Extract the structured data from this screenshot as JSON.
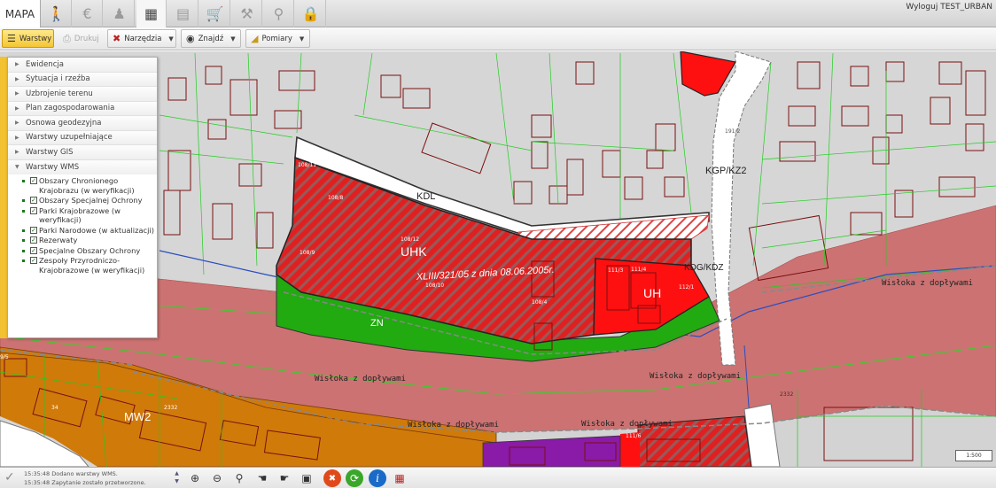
{
  "topbar": {
    "tab_label": "MAPA",
    "icons": [
      "walking-person-icon",
      "euro-icon",
      "person-icon",
      "building-icon",
      "document-list-icon",
      "cart-icon",
      "hammer-icon",
      "search-icon",
      "lock-icon"
    ],
    "logout_label": "Wyloguj TEST_URBAN"
  },
  "toolbar": {
    "layers_label": "Warstwy",
    "print_label": "Drukuj",
    "tools_label": "Narzędzia",
    "find_label": "Znajdź",
    "measure_label": "Pomiary"
  },
  "layers": {
    "groups": [
      "Ewidencja",
      "Sytuacja i rzeźba",
      "Uzbrojenie terenu",
      "Plan zagospodarowania",
      "Osnowa geodezyjna",
      "Warstwy uzupełniające",
      "Warstwy GIS"
    ],
    "wms_group": "Warstwy WMS",
    "wms_items": [
      {
        "label": "Obszary Chronionego Krajobrazu (w weryfikacji)",
        "checked": true
      },
      {
        "label": "Obszary Specjalnej Ochrony",
        "checked": true
      },
      {
        "label": "Parki Krajobrazowe (w weryfikacji)",
        "checked": true
      },
      {
        "label": "Parki Narodowe (w aktualizacji)",
        "checked": true
      },
      {
        "label": "Rezerwaty",
        "checked": true
      },
      {
        "label": "Specjalne Obszary Ochrony",
        "checked": true
      },
      {
        "label": "Zespoły Przyrodniczo-Krajobrazowe (w weryfikacji)",
        "checked": true
      }
    ]
  },
  "map": {
    "labels": {
      "kdl": "KDL",
      "kgpkz2": "KGP/KZ2",
      "kdgkdz": "KDG/KDZ",
      "uhk": "UHK",
      "uh": "UH",
      "zn": "ZN",
      "mw2": "MW2",
      "resolution": "XLIII/321/05 z dnia 08.06.2005r.",
      "river": "Wisłoka z dopływami"
    },
    "parcels": [
      "108/11",
      "108/8",
      "108/12",
      "108/9",
      "108/10",
      "108/4",
      "111/3",
      "111/4",
      "112/1",
      "2332",
      "2332",
      "191/2",
      "111/6",
      "9/5",
      "34"
    ],
    "scale_text": "1:500"
  },
  "status": {
    "log": [
      "15:35:48 Dodano warstwy WMS.",
      "15:35:48 Zapytanie zostało przetworzone."
    ],
    "tools": [
      "zoom-in-icon",
      "zoom-out-icon",
      "zoom-extent-icon",
      "zoom-previous-icon",
      "zoom-next-icon",
      "zoom-window-icon",
      "clear-icon",
      "refresh-icon",
      "info-icon",
      "legend-icon"
    ]
  },
  "colors": {
    "accent": "#f2c230",
    "river": "#cc7272",
    "road": "#d3d3d3",
    "residential": "#d07a0a",
    "commercial": "#ff0000",
    "green": "#22aa11",
    "service": "#8a1aa8"
  }
}
